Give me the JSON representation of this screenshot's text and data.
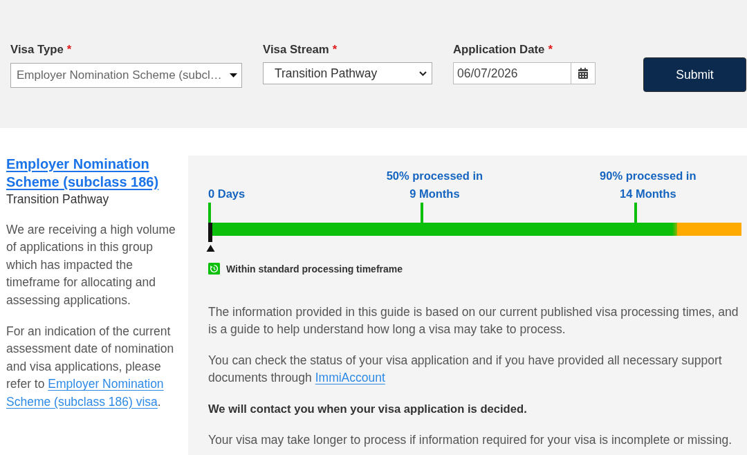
{
  "form": {
    "fields": [
      {
        "kind": "dropdown",
        "label": "Visa Type",
        "required_mark": "*",
        "value": "Employer Nomination Scheme (subcl…"
      },
      {
        "kind": "select",
        "label": "Visa Stream",
        "required_mark": "*",
        "value": "Transition Pathway"
      },
      {
        "kind": "date",
        "label": "Application Date",
        "required_mark": "*",
        "value": "06/07/2026"
      }
    ],
    "submit": "Submit"
  },
  "summary": {
    "title": "Employer Nomination Scheme (subclass 186)",
    "subtitle": "Transition Pathway",
    "paragraphs": [
      [
        {
          "kind": "text",
          "text": "We are receiving a high volume of applications in this group which has impacted the timeframe for allocating and assessing applications."
        }
      ],
      [
        {
          "kind": "text",
          "text": "For an indication of the current assessment date of nomination and visa applications, please refer to "
        },
        {
          "kind": "link",
          "lines": [
            "Employer Nomination",
            "Scheme (subclass 186) visa"
          ]
        },
        {
          "kind": "text",
          "text": "."
        }
      ]
    ]
  },
  "timeline": {
    "markers": [
      {
        "kind": "start",
        "value": "0 Days"
      },
      {
        "kind": "milestone",
        "title": "50% processed in",
        "value": "9 Months"
      },
      {
        "kind": "milestone",
        "title": "90% processed in",
        "value": "14 Months"
      }
    ],
    "bar": {
      "level": 0.88
    },
    "legend": {
      "label": "Within standard processing timeframe"
    }
  },
  "info": [
    {
      "kind": "text",
      "text": "The information provided in this guide is based on our current published visa processing times, and is a guide to help understand how long a visa may take to process."
    },
    {
      "kind": "text_link",
      "text": "You can check the status of your visa application and if you have provided all necessary support documents through ",
      "link": "ImmiAccount"
    },
    {
      "kind": "bold",
      "text": "We will contact you when your visa application is decided."
    },
    {
      "kind": "text",
      "text": "Your visa may take longer to process if information required for your visa is incomplete or missing."
    }
  ]
}
